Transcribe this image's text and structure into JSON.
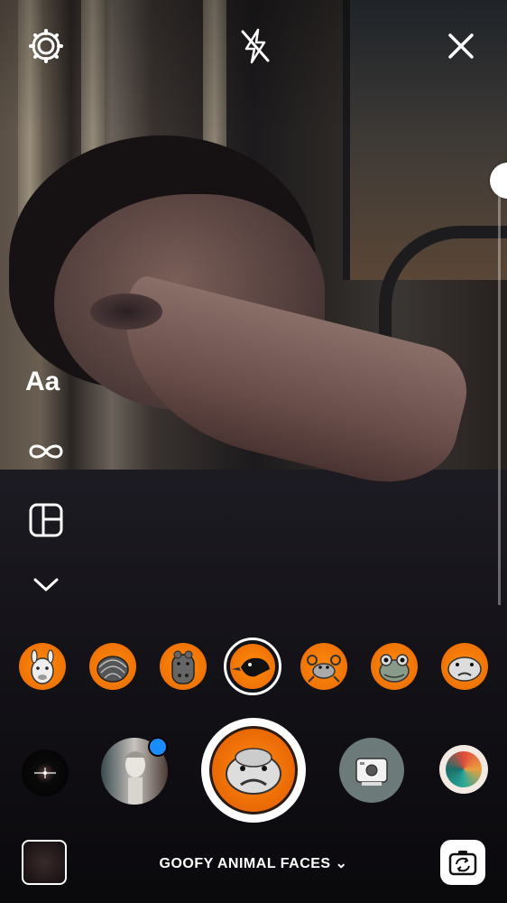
{
  "top_bar": {
    "settings_icon": "gear-icon",
    "flash_icon": "flash-off-icon",
    "close_icon": "close-icon"
  },
  "side_tools": {
    "text_label": "Aa",
    "boomerang_icon": "infinity-icon",
    "layout_icon": "layout-grid-icon",
    "more_icon": "chevron-down-icon"
  },
  "filters": [
    {
      "name": "llama-face-filter"
    },
    {
      "name": "pangolin-face-filter"
    },
    {
      "name": "hippo-face-filter"
    },
    {
      "name": "crow-face-filter",
      "selected": true
    },
    {
      "name": "crab-face-filter"
    },
    {
      "name": "frog-face-filter"
    },
    {
      "name": "blobfish-face-filter"
    }
  ],
  "effect": {
    "name": "GOOFY ANIMAL FACES",
    "chevron": "⌄"
  },
  "colors": {
    "filter_orange": "#f07a00",
    "notification_blue": "#1a8cff"
  }
}
